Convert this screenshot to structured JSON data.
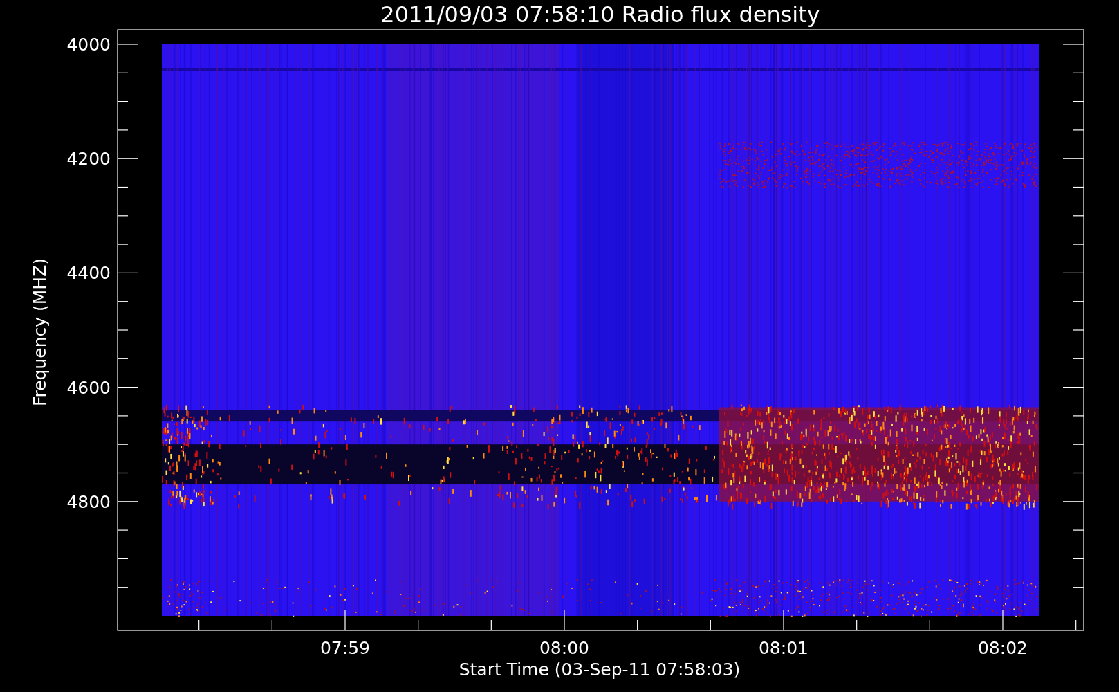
{
  "chart": {
    "title": "2011/09/03 07:58:10 Radio flux density",
    "ylabel": "Frequency (MHZ)",
    "xlabel": "Start Time (03-Sep-11 07:58:03)",
    "yticks": [
      "4000",
      "4200",
      "4400",
      "4600",
      "4800"
    ],
    "xticks": [
      "07:59",
      "08:00",
      "08:01",
      "08:02"
    ]
  }
}
